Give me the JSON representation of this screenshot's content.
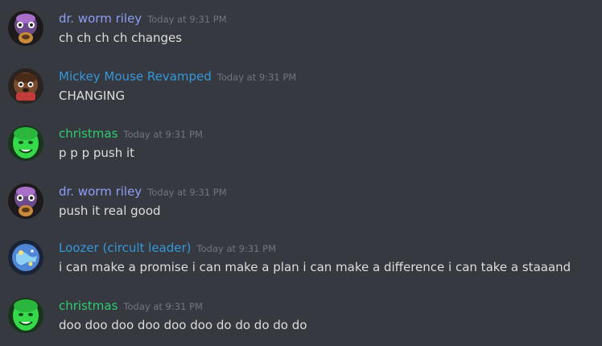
{
  "colors": {
    "background": "#36393f",
    "text": "#dcddde",
    "timestamp": "#72767d",
    "role_blue": "#7289da",
    "role_lightblue": "#3498db",
    "role_green": "#2ecc71"
  },
  "messages": [
    {
      "author": "dr. worm riley",
      "author_color": "#8e9ef7",
      "timestamp": "Today at 9:31 PM",
      "content": "ch ch ch ch changes",
      "avatar": "monkey-avatar"
    },
    {
      "author": "Mickey Mouse Revamped",
      "author_color": "#3498db",
      "timestamp": "Today at 9:31 PM",
      "content": "CHANGING",
      "avatar": "brown-character-avatar"
    },
    {
      "author": "christmas",
      "author_color": "#2ecc71",
      "timestamp": "Today at 9:31 PM",
      "content": "p p p push it",
      "avatar": "green-face-avatar"
    },
    {
      "author": "dr. worm riley",
      "author_color": "#8e9ef7",
      "timestamp": "Today at 9:31 PM",
      "content": "push it real good",
      "avatar": "monkey-avatar"
    },
    {
      "author": "Loozer (circult leader)",
      "author_color": "#3498db",
      "timestamp": "Today at 9:31 PM",
      "content": "i can make a promise i can make a plan i can make a difference i can take a staaand",
      "avatar": "blue-globe-avatar"
    },
    {
      "author": "christmas",
      "author_color": "#2ecc71",
      "timestamp": "Today at 9:31 PM",
      "content": "doo doo doo doo doo doo do do do do do",
      "avatar": "green-face-avatar"
    }
  ]
}
